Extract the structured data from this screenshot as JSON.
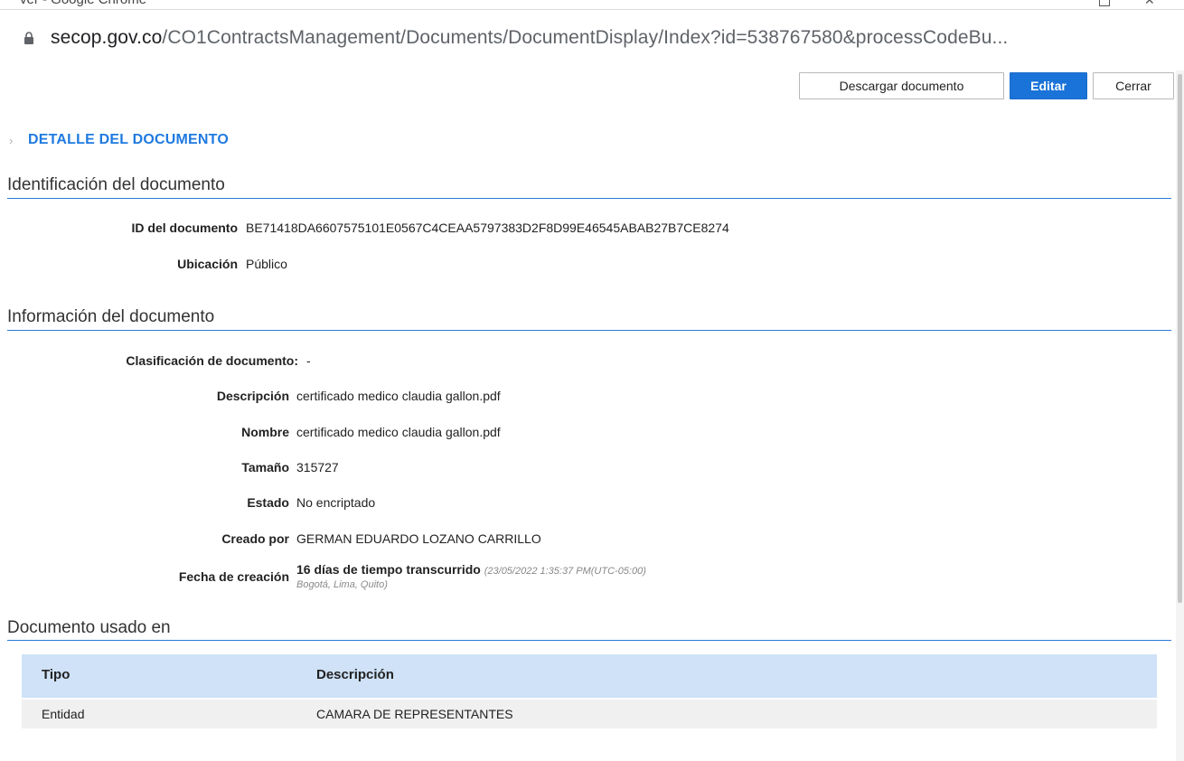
{
  "window": {
    "title": "ver - Google Chrome",
    "restore_glyph": "",
    "close_glyph": "✕"
  },
  "address_bar": {
    "domain": "secop.gov.co",
    "path": "/CO1ContractsManagement/Documents/DocumentDisplay/Index?id=538767580&processCodeBu..."
  },
  "toolbar": {
    "download_label": "Descargar documento",
    "edit_label": "Editar",
    "close_label": "Cerrar"
  },
  "page": {
    "chevron": "›",
    "section_title": "DETALLE DEL DOCUMENTO"
  },
  "identification": {
    "title": "Identificación del documento",
    "fields": [
      {
        "label": "ID del documento",
        "value": "BE71418DA6607575101E0567C4CEAA5797383D2F8D99E46545ABAB27B7CE8274"
      },
      {
        "label": "Ubicación",
        "value": "Público"
      }
    ]
  },
  "information": {
    "title": "Información del documento",
    "fields": [
      {
        "label": "Clasificación de documento:",
        "value": "-"
      },
      {
        "label": "Descripción",
        "value": "certificado medico claudia gallon.pdf"
      },
      {
        "label": "Nombre",
        "value": "certificado medico claudia gallon.pdf"
      },
      {
        "label": "Tamaño",
        "value": "315727"
      },
      {
        "label": "Estado",
        "value": "No encriptado"
      },
      {
        "label": "Creado por",
        "value": "GERMAN EDUARDO LOZANO CARRILLO"
      },
      {
        "label": "Fecha de creación",
        "value": "16 días de tiempo transcurrido",
        "meta": "(23/05/2022 1:35:37 PM(UTC-05:00)",
        "meta_line2": "Bogotá, Lima, Quito)"
      }
    ]
  },
  "usage": {
    "title": "Documento usado en",
    "columns": [
      "Tipo",
      "Descripción"
    ],
    "rows": [
      [
        "Entidad",
        "CAMARA DE REPRESENTANTES"
      ]
    ]
  },
  "colors": {
    "accent": "#1f7ae0",
    "primary_button": "#1a73d8",
    "table_header": "#cfe2f7",
    "table_row": "#f0f0f0",
    "rule": "#2a7bd6"
  },
  "icons": {
    "lock": "lock-icon",
    "chevron": "chevron-right-icon",
    "close": "close-icon",
    "restore": "restore-icon"
  }
}
